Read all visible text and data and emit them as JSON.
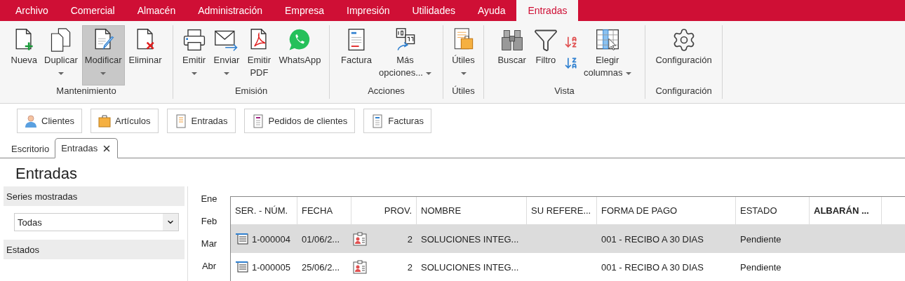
{
  "menu": [
    {
      "label": "Archivo",
      "selected": false
    },
    {
      "label": "Comercial",
      "selected": false
    },
    {
      "label": "Almacén",
      "selected": false
    },
    {
      "label": "Administración",
      "selected": false
    },
    {
      "label": "Empresa",
      "selected": false
    },
    {
      "label": "Impresión",
      "selected": false
    },
    {
      "label": "Utilidades",
      "selected": false
    },
    {
      "label": "Ayuda",
      "selected": false
    },
    {
      "label": "Entradas",
      "selected": true
    }
  ],
  "ribbon": [
    {
      "label": "Mantenimiento",
      "items": [
        {
          "kind": "new",
          "lines": [
            "Nueva"
          ],
          "selected": false
        },
        {
          "kind": "duplicate",
          "lines": [
            "Duplicar"
          ],
          "dropdown": true,
          "selected": false
        },
        {
          "kind": "edit",
          "lines": [
            "Modificar"
          ],
          "dropdown": true,
          "selected": true
        },
        {
          "kind": "delete",
          "lines": [
            "Eliminar"
          ],
          "selected": false
        }
      ]
    },
    {
      "label": "Emisión",
      "items": [
        {
          "kind": "print",
          "lines": [
            "Emitir"
          ],
          "dropdown": true,
          "selected": false
        },
        {
          "kind": "send",
          "lines": [
            "Enviar"
          ],
          "dropdown": true,
          "selected": false
        },
        {
          "kind": "pdf",
          "lines": [
            "Emitir",
            "PDF"
          ],
          "selected": false
        },
        {
          "kind": "whatsapp",
          "lines": [
            "WhatsApp"
          ],
          "selected": false
        }
      ]
    },
    {
      "label": "Acciones",
      "items": [
        {
          "kind": "invoice",
          "lines": [
            "Factura"
          ],
          "selected": false
        },
        {
          "kind": "more",
          "lines": [
            "Más",
            "opciones..."
          ],
          "dropdown": true,
          "selected": false
        }
      ]
    },
    {
      "label": "Útiles",
      "items": [
        {
          "kind": "tools",
          "lines": [
            "Útiles"
          ],
          "dropdown": true,
          "selected": false
        }
      ]
    },
    {
      "label": "Vista",
      "items": [
        {
          "kind": "find",
          "lines": [
            "Buscar"
          ],
          "selected": false
        },
        {
          "kind": "filter",
          "lines": [
            "Filtro"
          ],
          "selected": false
        },
        {
          "kind": "sort",
          "selected": false
        },
        {
          "kind": "columns",
          "lines": [
            "Elegir",
            "columnas"
          ],
          "dropdown": true,
          "selected": false
        }
      ]
    },
    {
      "label": "Configuración",
      "items": [
        {
          "kind": "settings",
          "lines": [
            "Configuración"
          ],
          "selected": false
        }
      ]
    }
  ],
  "shortcuts": [
    {
      "kind": "client",
      "label": "Clientes"
    },
    {
      "kind": "article",
      "label": "Artículos"
    },
    {
      "kind": "entry",
      "label": "Entradas"
    },
    {
      "kind": "order",
      "label": "Pedidos de clientes"
    },
    {
      "kind": "invoice",
      "label": "Facturas"
    }
  ],
  "doc_tabs": [
    {
      "label": "Escritorio",
      "selected": false,
      "closable": false
    },
    {
      "label": "Entradas",
      "selected": true,
      "closable": true
    }
  ],
  "page_title": "Entradas",
  "filters": {
    "series_label": "Series mostradas",
    "series_value": "Todas",
    "states_label": "Estados"
  },
  "months": [
    "Ene",
    "Feb",
    "Mar",
    "Abr"
  ],
  "table": {
    "columns": [
      {
        "label": "SER. - NÚM."
      },
      {
        "label": "FECHA"
      },
      {
        "label": "PROV."
      },
      {
        "label": "NOMBRE"
      },
      {
        "label": "SU REFERE..."
      },
      {
        "label": "FORMA DE PAGO"
      },
      {
        "label": "ESTADO"
      },
      {
        "label": "ALBARÁN ...",
        "bold": true
      }
    ],
    "rows": [
      {
        "selected": true,
        "number": "1-000004",
        "date": "01/06/2...",
        "provider": "2",
        "name": "SOLUCIONES INTEG...",
        "payment": "001 - RECIBO A 30 DIAS",
        "status": "Pendiente"
      },
      {
        "selected": false,
        "number": "1-000005",
        "date": "25/06/2...",
        "provider": "2",
        "name": "SOLUCIONES INTEG...",
        "payment": "001 - RECIBO A 30 DIAS",
        "status": "Pendiente"
      }
    ]
  }
}
